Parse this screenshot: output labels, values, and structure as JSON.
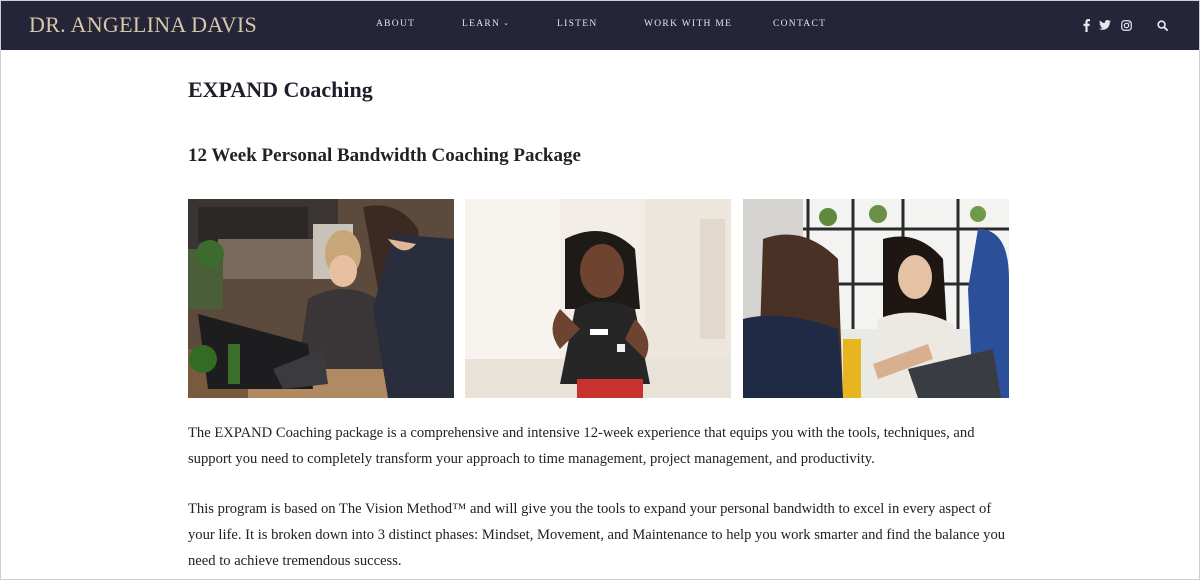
{
  "header": {
    "brand": "DR. ANGELINA DAVIS",
    "nav": [
      {
        "label": "ABOUT"
      },
      {
        "label": "LEARN",
        "has_dropdown": true
      },
      {
        "label": "LISTEN"
      },
      {
        "label": "WORK WITH ME"
      },
      {
        "label": "CONTACT"
      }
    ],
    "social_icons": [
      "facebook-icon",
      "twitter-icon",
      "instagram-icon"
    ],
    "search_icon": "search-icon"
  },
  "main": {
    "title": "EXPAND Coaching",
    "subtitle": "12 Week Personal Bandwidth Coaching Package",
    "photos": [
      {
        "subject": "two women working at a laptop"
      },
      {
        "subject": "speaker gesturing while presenting"
      },
      {
        "subject": "two women talking at a table"
      }
    ],
    "paragraphs": [
      "The EXPAND Coaching package is a comprehensive and intensive 12-week experience that equips you with the tools, techniques, and support you need to completely transform your approach to time management, project management, and productivity.",
      "This program is based on The Vision Method™  and will give you the tools to expand your personal bandwidth to excel in every aspect of your life. It is broken down into 3 distinct phases: Mindset, Movement, and Maintenance to help you work smarter and find the balance you need to achieve tremendous success."
    ]
  },
  "colors": {
    "header_bg": "#242538",
    "brand_gold": "#d9c8a8",
    "nav_text": "#e6e6ee",
    "body_text": "#222222"
  }
}
